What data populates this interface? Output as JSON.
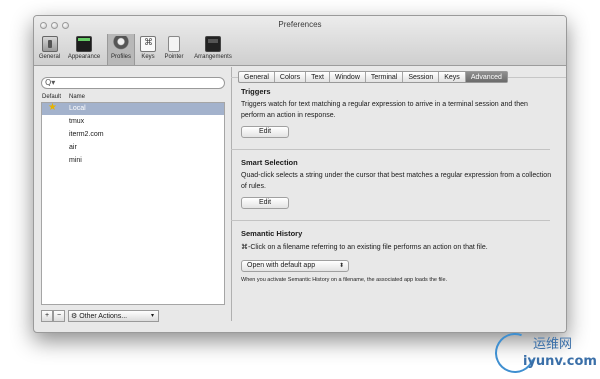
{
  "window": {
    "title": "Preferences"
  },
  "toolbar": {
    "items": [
      {
        "label": "General",
        "icon": "general-icon"
      },
      {
        "label": "Appearance",
        "icon": "appearance-icon"
      },
      {
        "label": "Profiles",
        "icon": "profiles-icon",
        "selected": true
      },
      {
        "label": "Keys",
        "icon": "keys-icon"
      },
      {
        "label": "Pointer",
        "icon": "pointer-icon"
      },
      {
        "label": "Arrangements",
        "icon": "arrangements-icon"
      }
    ]
  },
  "profiles": {
    "search_placeholder": "",
    "search_icon": "Q▾",
    "columns": {
      "default": "Default",
      "name": "Name"
    },
    "items": [
      "Local",
      "tmux",
      "iterm2.com",
      "air",
      "mini"
    ],
    "selected": "Local",
    "add_label": "+",
    "remove_label": "−",
    "other_actions_label": "Other Actions...",
    "gear_glyph": "⚙",
    "dropdown_glyph": "▾"
  },
  "tabs": [
    "General",
    "Colors",
    "Text",
    "Window",
    "Terminal",
    "Session",
    "Keys",
    "Advanced"
  ],
  "active_tab": "Advanced",
  "advanced": {
    "triggers": {
      "title": "Triggers",
      "text": "Triggers watch for text matching a regular expression to arrive in a terminal session and then perform an action in response.",
      "button": "Edit"
    },
    "smart_selection": {
      "title": "Smart Selection",
      "text": "Quad-click selects a string under the cursor that best matches a regular expression from a collection of rules.",
      "button": "Edit"
    },
    "semantic_history": {
      "title": "Semantic History",
      "text": "⌘-Click on a filename referring to an existing file performs an action on that file.",
      "select_value": "Open with default app",
      "select_arrow": "⬍",
      "note": "When you activate Semantic History on a filename, the associated app loads the file."
    }
  },
  "watermark": {
    "cn": "运维网",
    "en": "iyunv.com"
  },
  "colors": {
    "selection": "#a3b2cc",
    "star": "#e7b300",
    "watermark": "#3a6fa8"
  }
}
